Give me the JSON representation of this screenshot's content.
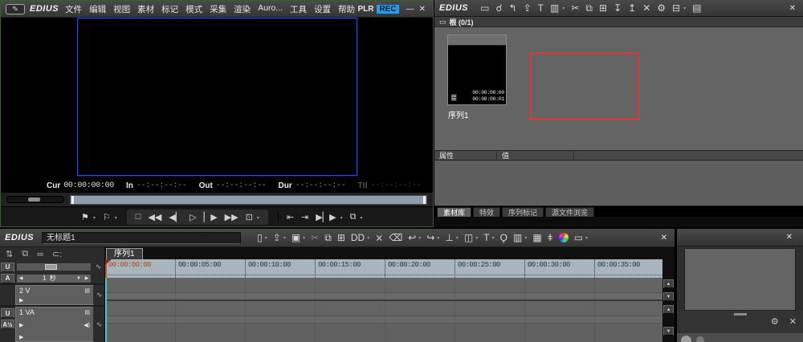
{
  "player": {
    "brand": "EDIUS",
    "logo_glyph": "✎",
    "menus": [
      "文件",
      "编辑",
      "视图",
      "素材",
      "标记",
      "模式",
      "采集",
      "渲染",
      "Auro...",
      "工具",
      "设置",
      "帮助"
    ],
    "plr_label": "PLR",
    "rec_label": "REC",
    "minimize_label": "—",
    "close_label": "✕",
    "timecodes": [
      {
        "label": "Cur",
        "value": "00:00:00:00",
        "state": "cur"
      },
      {
        "label": "In",
        "value": "--:--:--:--",
        "state": "dash"
      },
      {
        "label": "Out",
        "value": "--:--:--:--",
        "state": "dash"
      },
      {
        "label": "Dur",
        "value": "--:--:--:--",
        "state": "dash"
      },
      {
        "label": "Ttl",
        "value": "--:--:--:--",
        "state": "dim"
      }
    ],
    "transport_marks": [
      {
        "name": "mark-in-icon",
        "glyph": "⚑",
        "dd": true
      },
      {
        "name": "mark-out-icon",
        "glyph": "⚐",
        "dd": true
      }
    ],
    "transport_main": [
      {
        "name": "stop-icon",
        "glyph": "□"
      },
      {
        "name": "rewind-icon",
        "glyph": "◀◀"
      },
      {
        "name": "prev-frame-icon",
        "glyph": "◀▏"
      },
      {
        "name": "play-icon",
        "glyph": "▷"
      },
      {
        "name": "step-forward-icon",
        "glyph": "▏▶"
      },
      {
        "name": "fast-forward-icon",
        "glyph": "▶▶"
      },
      {
        "name": "display-mode-icon",
        "glyph": "⊡",
        "dd": true
      }
    ],
    "transport_extra": [
      {
        "name": "goto-in-icon",
        "glyph": "⇤"
      },
      {
        "name": "goto-out-icon",
        "glyph": "⇥"
      },
      {
        "name": "play-around-icon",
        "glyph": "▶▏▶",
        "dd": true
      },
      {
        "name": "export-icon",
        "glyph": "⧉",
        "dd": true
      }
    ]
  },
  "bin": {
    "brand": "EDIUS",
    "close_label": "✕",
    "toolbar": [
      {
        "name": "new-folder-icon",
        "glyph": "▭"
      },
      {
        "name": "search-icon",
        "glyph": "☌"
      },
      {
        "name": "folder-up-icon",
        "glyph": "↰"
      },
      {
        "name": "capture-icon",
        "glyph": "⇪"
      },
      {
        "name": "add-title-icon",
        "glyph": "T"
      },
      {
        "name": "colorbar-icon",
        "glyph": "▥",
        "dd": true
      },
      {
        "name": "cut-icon",
        "glyph": "✂"
      },
      {
        "name": "copy-icon",
        "glyph": "⧉"
      },
      {
        "name": "paste-icon",
        "glyph": "⊞"
      },
      {
        "name": "add-to-timeline-icon",
        "glyph": "↧"
      },
      {
        "name": "overwrite-timeline-icon",
        "glyph": "↥"
      },
      {
        "name": "delete-icon",
        "glyph": "✕"
      },
      {
        "name": "settings-icon",
        "glyph": "⚙"
      },
      {
        "name": "view-list-icon",
        "glyph": "⊟",
        "dd": true
      },
      {
        "name": "toolbox-icon",
        "glyph": "▤"
      }
    ],
    "folder_icon_glyph": "▭",
    "folder_label": "根 (0/1)",
    "clip": {
      "name": "序列1",
      "sequence_icon_glyph": "≣",
      "timecode_top": "00:00:00:00",
      "timecode_bottom": "00:00:00:01"
    },
    "properties": {
      "name_col": "属性",
      "value_col": "值"
    },
    "tabs": [
      {
        "label": "素材库",
        "active": true
      },
      {
        "label": "特效"
      },
      {
        "label": "序列标记"
      },
      {
        "label": "源文件浏览"
      }
    ]
  },
  "timeline": {
    "brand": "EDIUS",
    "project_name": "无标题1",
    "close_label": "✕",
    "toolbar": [
      {
        "name": "new-sequence-icon",
        "glyph": "▯",
        "dd": true
      },
      {
        "name": "open-project-icon",
        "glyph": "⇪",
        "dd": true
      },
      {
        "name": "save-project-icon",
        "glyph": "▣",
        "dd": true
      },
      {
        "name": "cut-icon",
        "glyph": "✂",
        "state": "dim"
      },
      {
        "name": "copy-icon",
        "glyph": "⧉"
      },
      {
        "name": "paste-icon",
        "glyph": "⊞"
      },
      {
        "name": "replace-icon",
        "glyph": "DD",
        "dd": true
      },
      {
        "name": "delete-icon",
        "glyph": "⨯"
      },
      {
        "name": "ripple-delete-icon",
        "glyph": "⌫"
      },
      {
        "name": "undo-icon",
        "glyph": "↩",
        "dd": true
      },
      {
        "name": "redo-icon",
        "glyph": "↪",
        "dd": true
      },
      {
        "name": "add-cut-point-icon",
        "glyph": "⊥",
        "dd": true
      },
      {
        "name": "transition-icon",
        "glyph": "◫",
        "dd": true
      },
      {
        "name": "title-icon",
        "glyph": "T",
        "dd": true
      },
      {
        "name": "voice-over-icon",
        "glyph": "Ϙ"
      },
      {
        "name": "render-icon",
        "glyph": "▥",
        "dd": true
      },
      {
        "name": "bin-icon",
        "glyph": "▦"
      },
      {
        "name": "mixer-icon",
        "glyph": "ǂ"
      },
      {
        "name": "color-correction-icon",
        "glyph": "●"
      },
      {
        "name": "monitor-mode-icon",
        "glyph": "▭",
        "dd": true
      }
    ],
    "modes": [
      {
        "name": "insert-overwrite-mode-icon",
        "glyph": "⇅",
        "state": "accent"
      },
      {
        "name": "ripple-mode-icon",
        "glyph": "⧉"
      },
      {
        "name": "sync-mode-icon",
        "glyph": "∞",
        "state": "accent"
      },
      {
        "name": "snap-mode-icon",
        "glyph": "⊂:"
      }
    ],
    "left_panel": {
      "mute_all": "U",
      "audio_master": "A",
      "zoom_value": "1 秒",
      "spin_left": "◀",
      "spin_right": "▶",
      "spin_down": "▼",
      "film_glyph": "▤",
      "speaker_glyph": "◀)",
      "patch_glyph": "∿",
      "expand_glyph": "▶",
      "track_v_label": "2 V",
      "track_va_label": "1 VA",
      "track_mute": "U",
      "track_audio": "A½"
    },
    "sequence_tab": "序列1",
    "ruler": [
      {
        "label": "00:00:00:00",
        "state": "current"
      },
      {
        "label": "00:00:05:00"
      },
      {
        "label": "00:00:10:00"
      },
      {
        "label": "00:00:15:00"
      },
      {
        "label": "00:00:20:00"
      },
      {
        "label": "00:00:25:00"
      },
      {
        "label": "00:00:30:00"
      },
      {
        "label": "00:00:35:00"
      }
    ],
    "scrollbar": {
      "up": "▲",
      "down": "▼"
    }
  },
  "info_panel": {
    "close_label": "✕",
    "detach_glyph": "⚙",
    "clear_glyph": "✕"
  }
}
